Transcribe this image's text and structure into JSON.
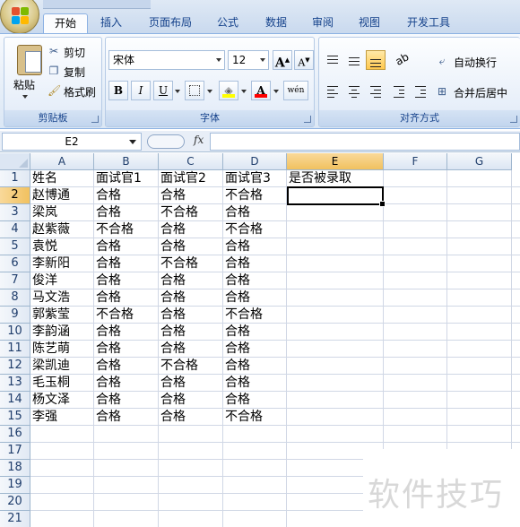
{
  "ribbon": {
    "tabs": [
      "开始",
      "插入",
      "页面布局",
      "公式",
      "数据",
      "审阅",
      "视图",
      "开发工具"
    ],
    "active_tab": "开始",
    "clipboard": {
      "paste": "粘贴",
      "cut": "剪切",
      "copy": "复制",
      "format_painter": "格式刷",
      "group_label": "剪贴板"
    },
    "font": {
      "font_name": "宋体",
      "font_size": "12",
      "grow": "A",
      "shrink": "A",
      "bold": "B",
      "italic": "I",
      "underline": "U",
      "font_color_letter": "A",
      "phonetic": "wén",
      "group_label": "字体"
    },
    "alignment": {
      "wrap_text": "自动换行",
      "merge_center": "合并后居中",
      "group_label": "对齐方式"
    }
  },
  "formula_bar": {
    "name_box": "E2",
    "fx": "fx",
    "formula": ""
  },
  "sheet": {
    "columns": [
      "A",
      "B",
      "C",
      "D",
      "E",
      "F",
      "G"
    ],
    "rows": [
      "1",
      "2",
      "3",
      "4",
      "5",
      "6",
      "7",
      "8",
      "9",
      "10",
      "11",
      "12",
      "13",
      "14",
      "15",
      "16",
      "17",
      "18",
      "19",
      "20",
      "21"
    ],
    "header_row": [
      "姓名",
      "面试官1",
      "面试官2",
      "面试官3",
      "是否被录取"
    ],
    "data": [
      [
        "赵博通",
        "合格",
        "合格",
        "不合格"
      ],
      [
        "梁岚",
        "合格",
        "不合格",
        "合格"
      ],
      [
        "赵紫薇",
        "不合格",
        "合格",
        "不合格"
      ],
      [
        "袁悦",
        "合格",
        "合格",
        "合格"
      ],
      [
        "李新阳",
        "合格",
        "不合格",
        "合格"
      ],
      [
        "俊洋",
        "合格",
        "合格",
        "合格"
      ],
      [
        "马文浩",
        "合格",
        "合格",
        "合格"
      ],
      [
        "郭紫莹",
        "不合格",
        "合格",
        "不合格"
      ],
      [
        "李韵涵",
        "合格",
        "合格",
        "合格"
      ],
      [
        "陈艺萌",
        "合格",
        "合格",
        "合格"
      ],
      [
        "梁凯迪",
        "合格",
        "不合格",
        "合格"
      ],
      [
        "毛玉桐",
        "合格",
        "合格",
        "合格"
      ],
      [
        "杨文泽",
        "合格",
        "合格",
        "合格"
      ],
      [
        "李强",
        "合格",
        "合格",
        "不合格"
      ]
    ],
    "active_cell": "E2",
    "selected_column": "E",
    "selected_row": "2"
  },
  "watermark": "软件技巧"
}
